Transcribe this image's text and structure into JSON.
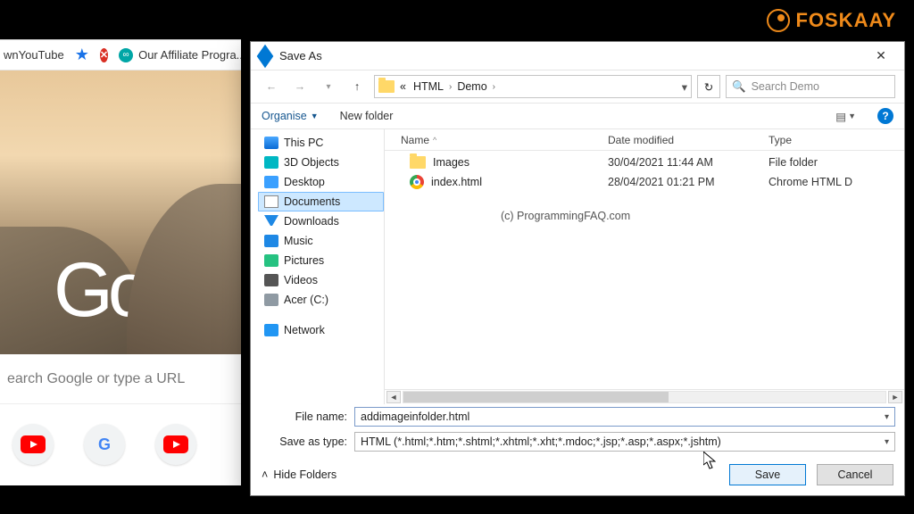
{
  "watermark": "FOSKAAY",
  "chrome": {
    "bookmark1": "wnYouTube",
    "bookmark2": "Our Affiliate Progra...",
    "logo_text": "Goo",
    "search_placeholder": "earch Google or type a URL"
  },
  "dialog": {
    "title": "Save As",
    "crumbs": {
      "prefix": "«",
      "a": "HTML",
      "b": "Demo"
    },
    "search_placeholder": "Search Demo",
    "toolbar": {
      "organise": "Organise",
      "new_folder": "New folder"
    },
    "columns": {
      "name": "Name",
      "modified": "Date modified",
      "type": "Type"
    },
    "tree": [
      {
        "label": "This PC",
        "icon": "pc"
      },
      {
        "label": "3D Objects",
        "icon": "3d"
      },
      {
        "label": "Desktop",
        "icon": "desk"
      },
      {
        "label": "Documents",
        "icon": "doc",
        "selected": true
      },
      {
        "label": "Downloads",
        "icon": "down"
      },
      {
        "label": "Music",
        "icon": "music"
      },
      {
        "label": "Pictures",
        "icon": "pic"
      },
      {
        "label": "Videos",
        "icon": "vid"
      },
      {
        "label": "Acer (C:)",
        "icon": "drive"
      },
      {
        "label": "Network",
        "icon": "net"
      }
    ],
    "files": [
      {
        "name": "Images",
        "kind": "folder",
        "modified": "30/04/2021 11:44 AM",
        "type": "File folder"
      },
      {
        "name": "index.html",
        "kind": "chrome",
        "modified": "28/04/2021 01:21 PM",
        "type": "Chrome HTML D"
      }
    ],
    "center_watermark": "(c) ProgrammingFAQ.com",
    "labels": {
      "file_name": "File name:",
      "save_as_type": "Save as type:"
    },
    "file_name_value": "addimageinfolder.html",
    "save_as_type_value": "HTML (*.html;*.htm;*.shtml;*.xhtml;*.xht;*.mdoc;*.jsp;*.asp;*.aspx;*.jshtm)",
    "hide_folders": "Hide Folders",
    "buttons": {
      "save": "Save",
      "cancel": "Cancel"
    }
  }
}
